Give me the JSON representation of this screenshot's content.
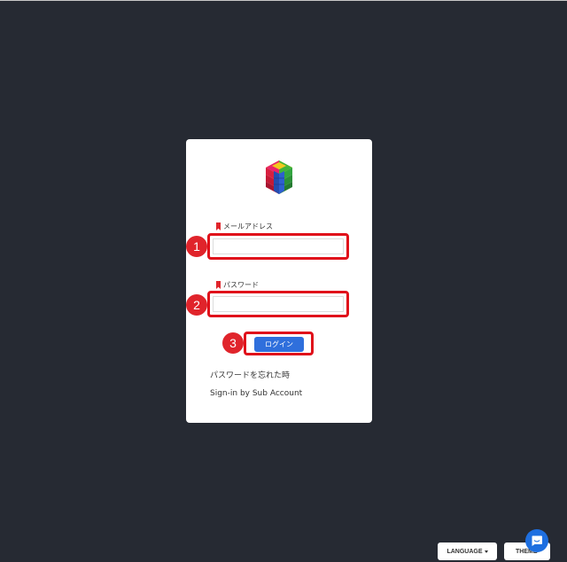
{
  "login": {
    "email_label": "メールアドレス",
    "email_value": "",
    "password_label": "パスワード",
    "password_value": "",
    "submit_label": "ログイン",
    "forgot_password": "パスワードを忘れた時",
    "sub_account": "Sign-in by Sub Account"
  },
  "annotations": {
    "badge_1": "1",
    "badge_2": "2",
    "badge_3": "3"
  },
  "footer": {
    "language_label": "LANGUAGE",
    "theme_label": "THEME"
  },
  "icons": {
    "logo": "colorful-cube-logo-icon",
    "required": "bookmark-icon",
    "chat": "chat-bubble-icon",
    "caret": "caret-down-icon"
  },
  "colors": {
    "background": "#262a33",
    "card": "#ffffff",
    "highlight": "#e0101a",
    "badge": "#e0242b",
    "primary_button": "#2f6fdc",
    "chat_button": "#1e6fe0"
  }
}
